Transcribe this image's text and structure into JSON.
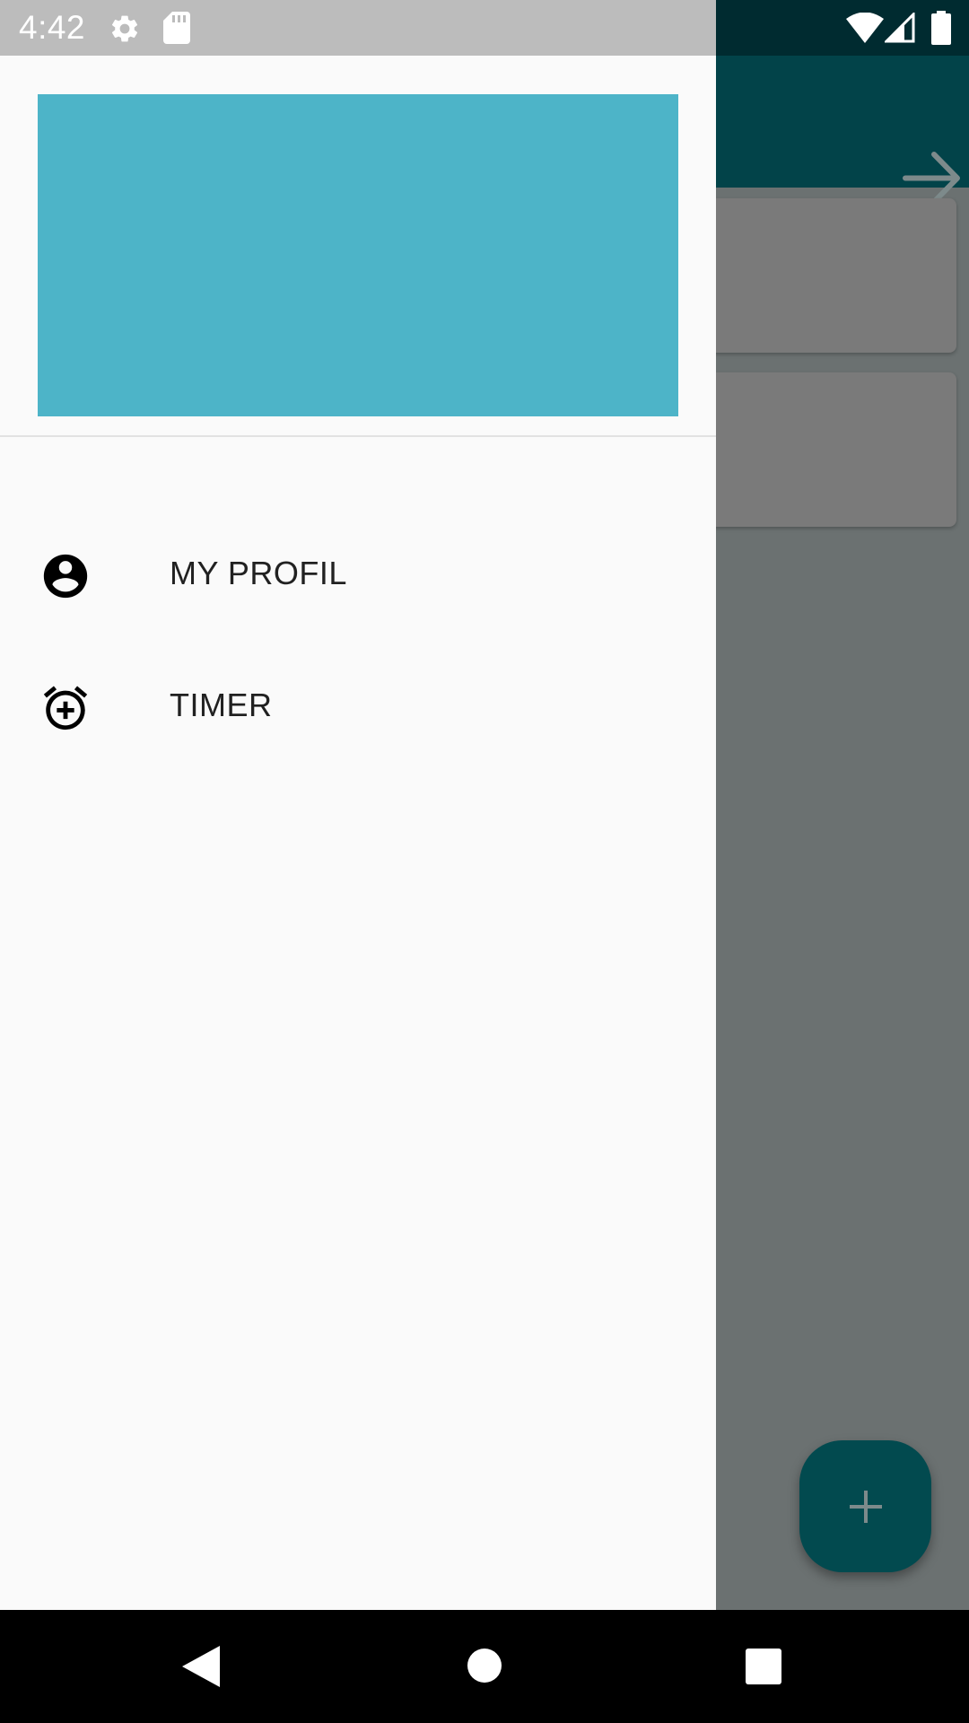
{
  "status_bar": {
    "time": "4:42",
    "left_icons": [
      "gear-icon",
      "sd-card-icon"
    ],
    "right_icons": [
      "wifi-icon",
      "signal-icon",
      "battery-icon"
    ]
  },
  "app": {
    "toolbar_action_icon": "arrow-forward-icon",
    "fab_icon": "plus-icon"
  },
  "drawer": {
    "header_color": "#4db4c8",
    "items": [
      {
        "label": "MY PROFIL",
        "icon": "account-circle-icon"
      },
      {
        "label": "TIMER",
        "icon": "alarm-add-icon"
      }
    ]
  },
  "nav_bar": {
    "icons": [
      "back-icon",
      "home-icon",
      "recents-icon"
    ]
  },
  "colors": {
    "primary": "#024349",
    "fab": "#024a4f",
    "drawer_bg": "#fafafa",
    "scrim_content": "#6b7171"
  }
}
